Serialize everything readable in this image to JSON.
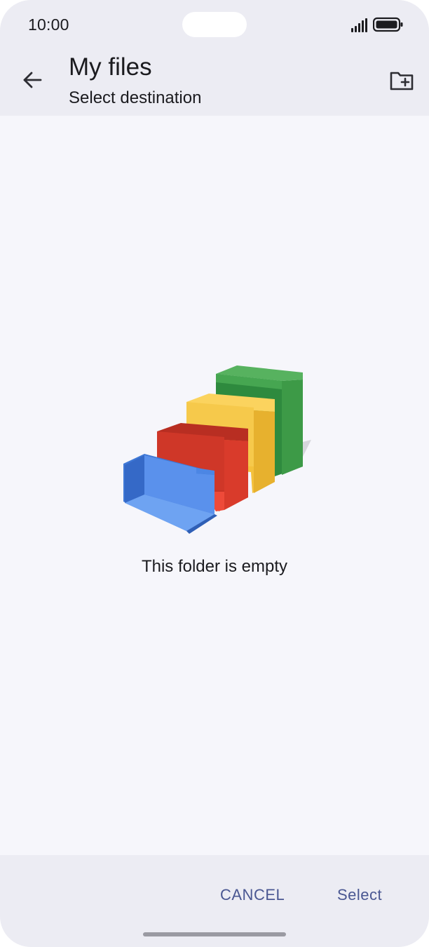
{
  "status_bar": {
    "time": "10:00",
    "icons": [
      "signal-icon",
      "battery-icon"
    ]
  },
  "app_bar": {
    "title": "My files",
    "subtitle": "Select destination",
    "icons": [
      "back-arrow-icon",
      "new-folder-icon"
    ]
  },
  "empty_state": {
    "message": "This folder is empty",
    "illustration": "empty-folders-illustration",
    "colors": {
      "blue": "#4a86e8",
      "red": "#d93b2b",
      "yellow": "#f6c94b",
      "green": "#3d9a47"
    }
  },
  "actions": {
    "cancel_label": "CANCEL",
    "select_label": "Select"
  },
  "colors": {
    "bar_background": "#ececf3",
    "page_background": "#f6f6fb",
    "action_text": "#4a5792"
  }
}
